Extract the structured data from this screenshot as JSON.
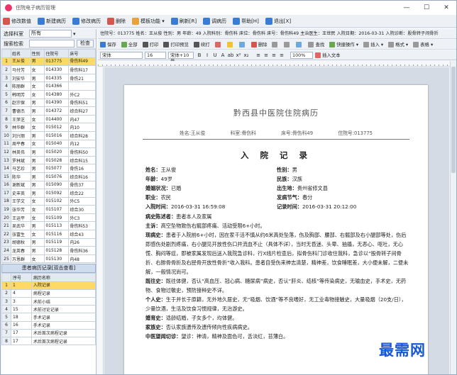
{
  "window": {
    "title": "住院电子病历管理",
    "min": "—",
    "max": "☐",
    "close": "✕"
  },
  "menu": [
    {
      "label": "修改数值",
      "color": "#d9534f"
    },
    {
      "label": "新建病历",
      "color": "#3a7bd5"
    },
    {
      "label": "修改病历",
      "color": "#3a7bd5"
    },
    {
      "label": "删除",
      "color": "#d9534f"
    },
    {
      "label": "模板功能 ▾",
      "color": "#e6a23c"
    },
    {
      "label": "刷新[R]",
      "color": "#3a7bd5"
    },
    {
      "label": "调病历",
      "color": "#3a7bd5"
    },
    {
      "label": "帮助[H]",
      "color": "#3a7bd5"
    },
    {
      "label": "退出[X]",
      "color": "#3a7bd5"
    }
  ],
  "filters": {
    "dept_label": "选择科室",
    "dept_value": "所有",
    "search_label": "搜索检索",
    "search_button": "检查"
  },
  "patients": {
    "headers": [
      "",
      "姓名",
      "性别",
      "住院号",
      "床号"
    ],
    "rows": [
      [
        "1",
        "王从俊",
        "男",
        "013775",
        "骨伤科49"
      ],
      [
        "2",
        "马付芳",
        "女",
        "014330",
        "骨伤科17"
      ],
      [
        "3",
        "刘安华",
        "男",
        "014335",
        "骨伤21"
      ],
      [
        "4",
        "陈丽群",
        "女",
        "014366",
        ""
      ],
      [
        "5",
        "韩明芳",
        "女",
        "014380",
        "外C2"
      ],
      [
        "6",
        "赵宗保",
        "男",
        "014390",
        "骨伤科51"
      ],
      [
        "7",
        "曹德杰",
        "男",
        "014372",
        "综合科27"
      ],
      [
        "8",
        "王萍芝",
        "女",
        "014400",
        "内47"
      ],
      [
        "9",
        "林华群",
        "女",
        "015012",
        "内10"
      ],
      [
        "10",
        "刘兴丽",
        "男",
        "015016",
        "综合科28"
      ],
      [
        "11",
        "周平春",
        "女",
        "015040",
        "内12"
      ],
      [
        "12",
        "林英伟",
        "男",
        "015020",
        "骨伤科50"
      ],
      [
        "13",
        "罗林斌",
        "男",
        "015028",
        "综合科15"
      ],
      [
        "14",
        "马艺珍",
        "男",
        "015077",
        "骨伤16"
      ],
      [
        "15",
        "陈华",
        "男",
        "015076",
        "综合科16"
      ],
      [
        "16",
        "谢新斌",
        "男",
        "015090",
        "骨伤37"
      ],
      [
        "17",
        "史丰英",
        "男",
        "015092",
        "综合22"
      ],
      [
        "18",
        "王学文",
        "女",
        "015102",
        "外C5"
      ],
      [
        "19",
        "张华芳",
        "女",
        "015107",
        "综合30"
      ],
      [
        "20",
        "王运平",
        "女",
        "015109",
        "外C3"
      ],
      [
        "21",
        "吴武华",
        "男",
        "015113",
        "骨伤科53"
      ],
      [
        "22",
        "张富生",
        "女",
        "015116",
        "综合43"
      ],
      [
        "23",
        "胡德秋",
        "男",
        "015119",
        "内26"
      ],
      [
        "24",
        "龙英春",
        "男",
        "015128",
        "骨伤科36"
      ],
      [
        "25",
        "万恩群",
        "女",
        "015130",
        "内48"
      ]
    ]
  },
  "records_section_title": "患者病历记录[双击查看]",
  "records": {
    "headers": [
      "",
      "序号",
      "病历名称"
    ],
    "rows": [
      [
        "1",
        "1",
        "入院记录"
      ],
      [
        "2",
        "4",
        "病程记录"
      ],
      [
        "3",
        "3",
        "术前小结"
      ],
      [
        "4",
        "15",
        "术前讨论记录"
      ],
      [
        "5",
        "18",
        "手术记录"
      ],
      [
        "6",
        "16",
        "手术记录"
      ],
      [
        "7",
        "17",
        "术后首次病程记录"
      ],
      [
        "8",
        "17",
        "术后首次病程记录"
      ]
    ]
  },
  "infobar": "住院号：013775  姓名：王从俊  性别：男  年龄：49  入院科别：骨伤科  床位：骨伤科  床号：骨伤科49  主治医生：王世民  入院日期：2016-03-31  入院诊断：股骨转子间骨折",
  "toolbar1": [
    {
      "label": "保存",
      "color": "#3a7bd5"
    },
    {
      "label": "全部",
      "color": "#6aa84f"
    },
    {
      "label": "打印",
      "color": "#555"
    },
    {
      "label": "打印预览",
      "color": "#555"
    },
    {
      "label": "续打",
      "color": "#555"
    },
    {
      "label": "",
      "color": "#e06666"
    },
    {
      "label": "",
      "color": "#f1c232"
    },
    {
      "label": "",
      "color": "#6fa8dc"
    },
    {
      "label": "删除",
      "color": "#d9534f"
    },
    {
      "label": "",
      "color": "#999"
    },
    {
      "label": "",
      "color": "#999"
    },
    {
      "label": "",
      "color": "#6fa8dc"
    },
    {
      "label": "查找",
      "color": "#999"
    },
    {
      "label": "快捷操作 ▾",
      "color": "#6aa84f"
    },
    {
      "label": "插入 ▾",
      "color": "#999"
    },
    {
      "label": "格式 ▾",
      "color": "#999"
    },
    {
      "label": "表格 ▾",
      "color": "#999"
    }
  ],
  "toolbar2": {
    "font": "宋体",
    "size": "16",
    "style_label": "宋体+10号",
    "format_buttons": [
      "B",
      "I",
      "U",
      "A",
      "ab",
      "x²",
      "x₂"
    ],
    "align_buttons": [
      "≡",
      "≡",
      "≡",
      "≡"
    ],
    "zoom": "100%",
    "insert_text": "插入文本"
  },
  "document": {
    "hospital": "黔西县中医院住院病历",
    "sub_name": "姓名:王从俊",
    "sub_dept": "科室:骨伤科",
    "sub_bed": "床号:骨伤科49",
    "sub_no": "住院号:013775",
    "record_title": "入 院 记 录",
    "fields": [
      [
        "姓名：",
        "王从俊",
        "性别：",
        "男"
      ],
      [
        "年龄：",
        "49岁",
        "民族：",
        "汉族"
      ],
      [
        "婚姻状况：",
        "已婚",
        "出生地：",
        "贵州省修文县"
      ],
      [
        "职业：",
        "农民",
        "发病节气：",
        "春分"
      ],
      [
        "入院时间：",
        "2016-03-31  16:59:08",
        "记录时间：",
        "2016-03-31  20:12:00"
      ]
    ],
    "paragraphs": [
      {
        "label": "病史陈述者：",
        "text": "患者本人及家属"
      },
      {
        "label": "主诉：",
        "text": "高空坠物致伤右髋部疼痛、活动受限6+小时。"
      },
      {
        "label": "现病史：",
        "text": "患者于入院前6+小时，因在家干活不慎从约6米高处坠落，伤及胸部、腰部、右髋部及右小腿部等处，伤后即感伤处剧烈疼痛，右小腿见开放性伤口并流血不止（具体不详），当时无昏迷、头晕、抽搐，无恶心、呕吐，无心慌、胸闷等症，即被家属发现后送入我院急诊科，行X线片检查后，拟骨伤科门诊收住我科，急诊以“股骨转子间骨折、右腓骨骨折及右胫骨开放性骨折”收入我科。患者自受伤来神志清楚，精神差，饮食睡眠差，大小便未解，二便未解，一般情况尚可。"
      },
      {
        "label": "既往史：",
        "text": "既往体健，否认“高血压、冠心病、糖尿病”病史，否认“肝炎、结核”等传染病史，无输血史，手术史，无药物、食物过敏史，预防接种史不详。"
      },
      {
        "label": "个人史：",
        "text": "生于并长于原籍，无外地久居史，无“吸烟、饮酒”等不良嗜好，无工业毒物接触史，大量吸烟（20支/日），少量饮酒，生活及饮食习惯规律，无治游史。"
      },
      {
        "label": "婚育史：",
        "text": "适龄结婚，子女多个，均体健。"
      },
      {
        "label": "家族史：",
        "text": "否认家族遗传及遗传倾向性疾病病史。"
      },
      {
        "label": "中医望闻切诊：",
        "text": "望诊：神清，精神及面色可，舌淡红，苔薄白。"
      }
    ]
  },
  "watermark": "最需网"
}
